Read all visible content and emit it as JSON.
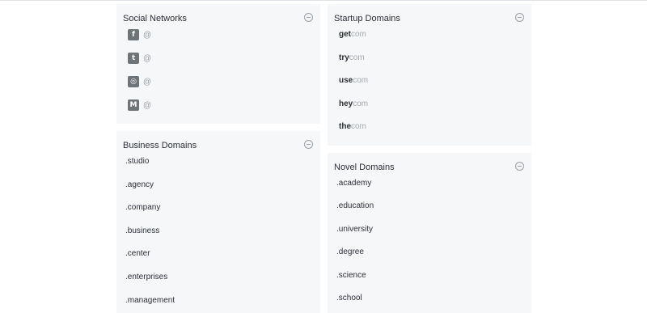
{
  "social": {
    "title": "Social Networks",
    "items": [
      {
        "icon": "facebook-icon",
        "glyph": "f",
        "prefix": "@"
      },
      {
        "icon": "twitter-icon",
        "glyph": "t",
        "prefix": "@"
      },
      {
        "icon": "instagram-icon",
        "glyph": "◎",
        "prefix": "@"
      },
      {
        "icon": "medium-icon",
        "glyph": "M",
        "prefix": "@"
      }
    ]
  },
  "startup": {
    "title": "Startup Domains",
    "items": [
      {
        "prefix": "get",
        "suffix": "com"
      },
      {
        "prefix": "try",
        "suffix": "com"
      },
      {
        "prefix": "use",
        "suffix": "com"
      },
      {
        "prefix": "hey",
        "suffix": "com"
      },
      {
        "prefix": "the",
        "suffix": "com"
      }
    ]
  },
  "business": {
    "title": "Business Domains",
    "items": [
      ".studio",
      ".agency",
      ".company",
      ".business",
      ".center",
      ".enterprises",
      ".management"
    ]
  },
  "novel": {
    "title": "Novel Domains",
    "items": [
      ".academy",
      ".education",
      ".university",
      ".degree",
      ".science",
      ".school"
    ]
  }
}
